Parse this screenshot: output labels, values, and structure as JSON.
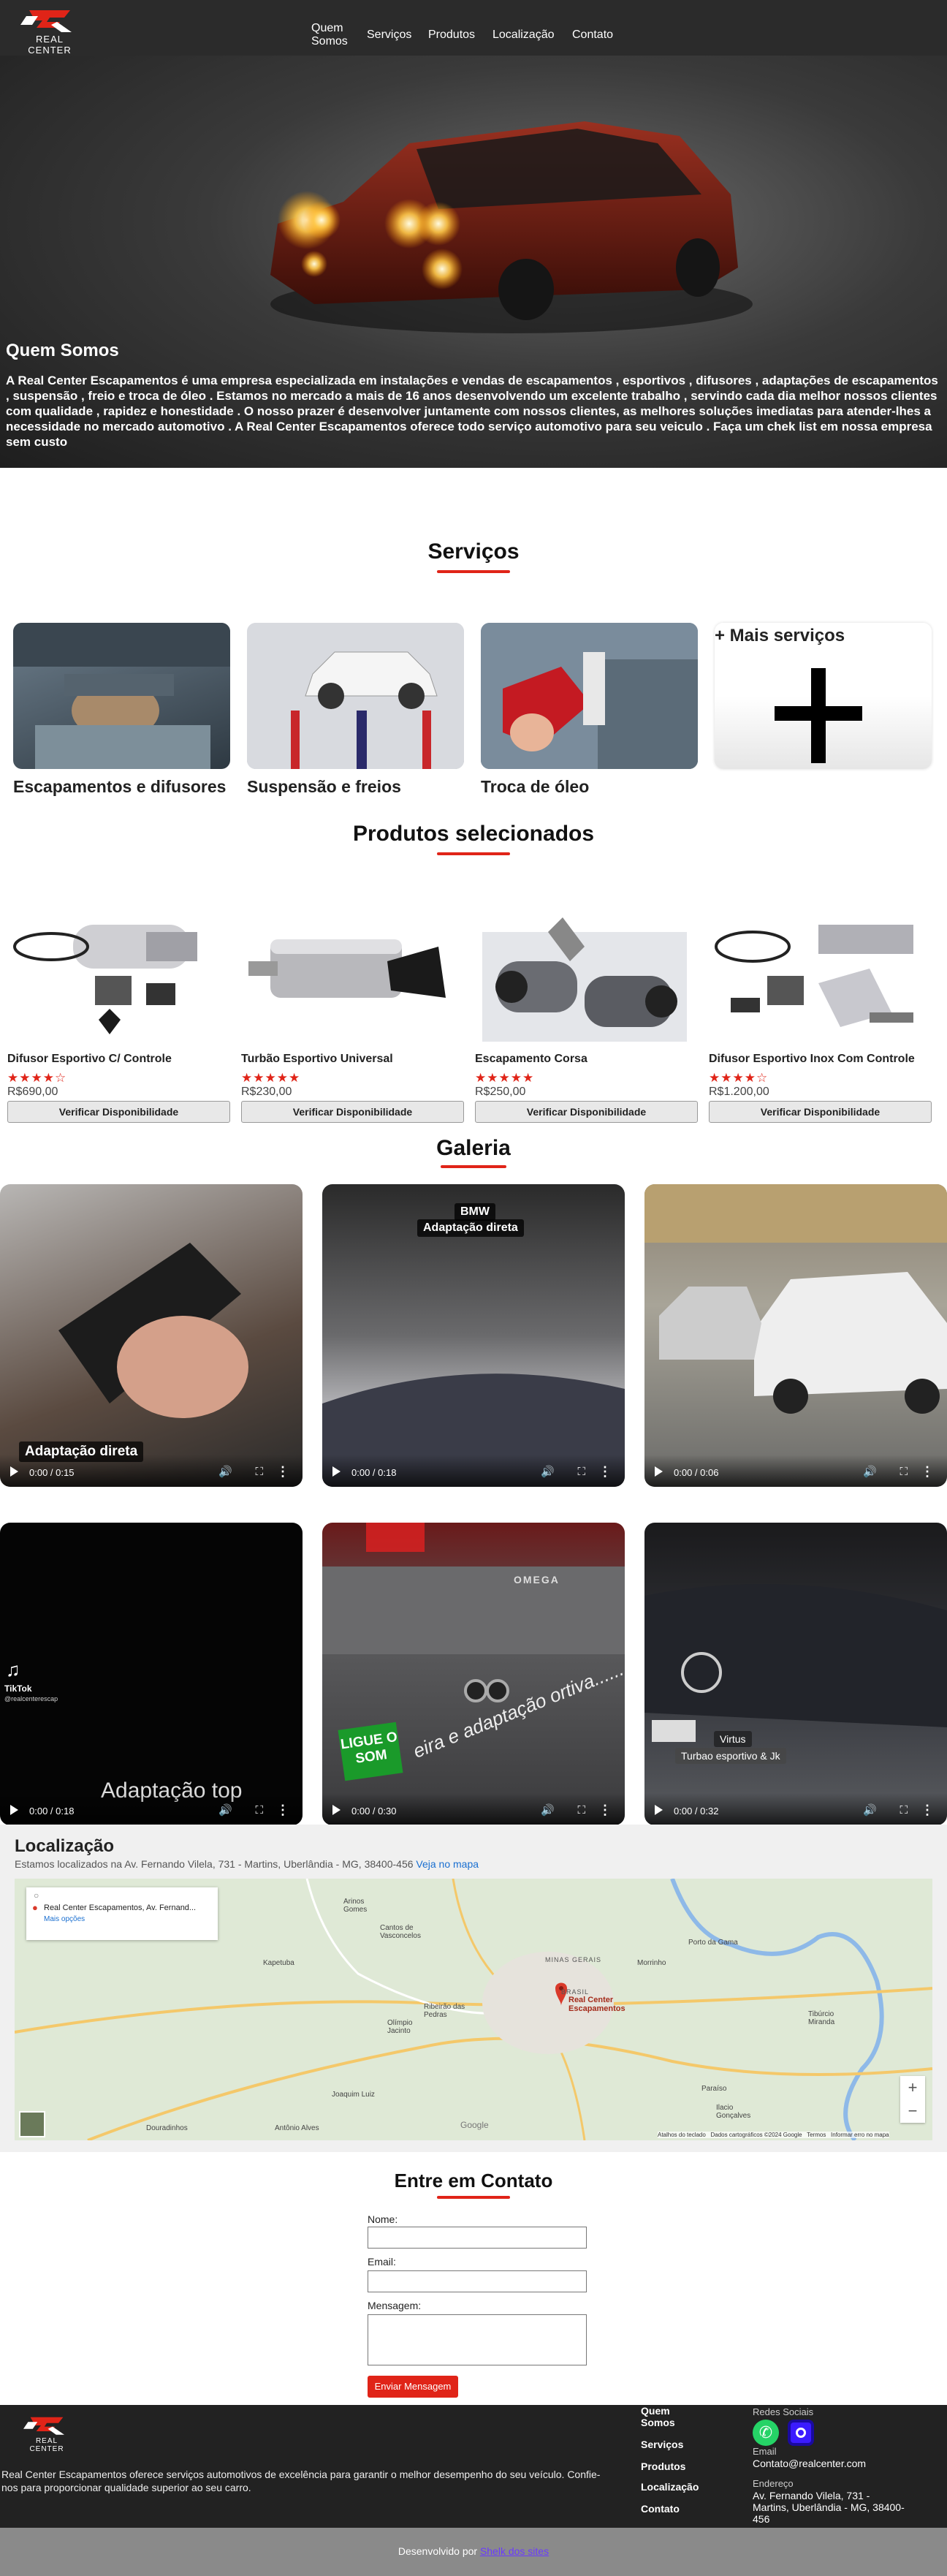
{
  "nav": {
    "logo_text": "REAL CENTER",
    "links": [
      "Quem Somos",
      "Serviços",
      "Produtos",
      "Localização",
      "Contato"
    ]
  },
  "hero": {
    "title": "Quem Somos",
    "text": "A Real Center Escapamentos é uma empresa especializada em instalações e vendas de escapamentos , esportivos , difusores , adaptações de escapamentos , suspensão , freio e troca de óleo . Estamos no mercado a mais de 16 anos desenvolvendo um excelente trabalho , servindo cada dia melhor nossos clientes com qualidade , rapidez e honestidade . O nosso prazer é desenvolver juntamente com nossos clientes, as melhores soluções imediatas para atender-lhes a necessidade no mercado automotivo . A Real Center Escapamentos oferece todo serviço automotivo para seu veiculo . Faça um chek list em nossa empresa sem custo"
  },
  "services": {
    "title": "Serviços",
    "items": [
      {
        "label": "Escapamentos e difusores"
      },
      {
        "label": "Suspensão e freios"
      },
      {
        "label": "Troca de óleo"
      }
    ],
    "more_label": "+ Mais serviços"
  },
  "products": {
    "title": "Produtos selecionados",
    "button_label": "Verificar Disponibilidade",
    "items": [
      {
        "name": "Difusor Esportivo C/ Controle",
        "rating": 4,
        "stars": "★★★★☆",
        "price": "R$690,00"
      },
      {
        "name": "Turbão Esportivo Universal",
        "rating": 5,
        "stars": "★★★★★",
        "price": "R$230,00"
      },
      {
        "name": "Escapamento Corsa",
        "rating": 5,
        "stars": "★★★★★",
        "price": "R$250,00"
      },
      {
        "name": "Difusor Esportivo Inox Com Controle",
        "rating": 4,
        "stars": "★★★★☆",
        "price": "R$1.200,00"
      }
    ]
  },
  "gallery": {
    "title": "Galeria",
    "videos": [
      {
        "time": "0:00 / 0:15",
        "overlay": "Adaptação direta"
      },
      {
        "time": "0:00 / 0:18",
        "overlay_top": "BMW",
        "overlay": "Adaptação direta"
      },
      {
        "time": "0:00 / 0:06"
      },
      {
        "time": "0:00 / 0:18",
        "brand": "TikTok",
        "handle": "@realcenterescap",
        "overlay": "Adaptação top"
      },
      {
        "time": "0:00 / 0:30",
        "overlay_badge": "LIGUE O SOM",
        "overlay": "eira e adaptação ortiva......",
        "car_text": "OMEGA"
      },
      {
        "time": "0:00 / 0:32",
        "overlay_top": "Virtus",
        "overlay": "Turbao esportivo & Jk"
      }
    ]
  },
  "location": {
    "title": "Localização",
    "address_line": "Estamos localizados na Av. Fernando Vilela, 731 - Martins, Uberlândia - MG, 38400-456",
    "map_link": "Veja no mapa",
    "map_card_title": "Real Center Escapamentos, Av. Fernand...",
    "map_card_options": "Mais opções",
    "pin_label": "Real Center Escapamentos",
    "places": [
      "Arinos Gomes",
      "Cantos de Vasconcelos",
      "Kapetuba",
      "Ribeirão das Pedras",
      "Olímpio Jacinto",
      "Joaquim Luiz",
      "Douradinhos",
      "Antônio Alves",
      "Porto da Gama",
      "MINAS GERAIS",
      "BRASIL",
      "Morrinho",
      "Tibúrcio Miranda",
      "Paraíso",
      "Ilacio Gonçalves"
    ],
    "attribution": [
      "Atalhos do teclado",
      "Dados cartográficos ©2024 Google",
      "Termos",
      "Informar erro no mapa"
    ],
    "google": "Google"
  },
  "contact": {
    "title": "Entre em Contato",
    "name_label": "Nome:",
    "email_label": "Email:",
    "message_label": "Mensagem:",
    "send_label": "Enviar Mensagem"
  },
  "footer": {
    "logo_text": "REAL CENTER",
    "description": "Real Center Escapamentos oferece serviços automotivos de excelência para garantir o melhor desempenho do seu veículo. Confie-nos para proporcionar qualidade superior ao seu carro.",
    "links": [
      "Quem Somos",
      "Serviços",
      "Produtos",
      "Localização",
      "Contato"
    ],
    "social_heading": "Redes Sociais",
    "email_heading": "Email",
    "email": "Contato@realcenter.com",
    "address_heading": "Endereço",
    "address": "Av. Fernando Vilela, 731 - Martins, Uberlândia - MG, 38400-456",
    "dev_prefix": "Desenvolvido por",
    "dev_name": "Shelk dos sites"
  },
  "colors": {
    "accent": "#e02418",
    "nav_bg": "#2b2b2b",
    "footer_bg": "#222222",
    "dev_bar": "#8a8a8a",
    "whatsapp": "#25d366",
    "instagram": "#3b1bff"
  }
}
